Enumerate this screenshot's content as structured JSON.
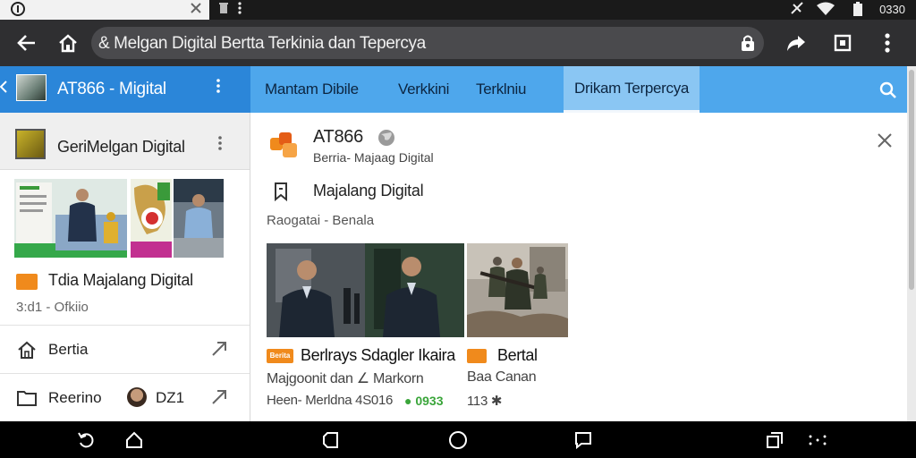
{
  "status_bar": {
    "time": "0330",
    "tab_icon": "info-circle-icon",
    "icons": [
      "close-icon",
      "trash-icon",
      "more-vert-icon",
      "no-signal-icon",
      "wifi-icon",
      "battery-icon"
    ]
  },
  "browser": {
    "url_text": "& Melgan Digital Bertta Terkinia dan Tepercya",
    "buttons": [
      "back-arrow-icon",
      "home-icon",
      "lock-icon",
      "share-icon",
      "tabs-icon",
      "more-vert-icon"
    ]
  },
  "app_header": {
    "title": "AT866 - Migital"
  },
  "tabs": [
    {
      "label": "Mantam Dibile",
      "active": false
    },
    {
      "label": "Verkkini",
      "active": false
    },
    {
      "label": "Terklniu",
      "active": false
    },
    {
      "label": "Drikam Terpercya",
      "active": true
    }
  ],
  "sidebar": {
    "group_title": "GeriMelgan Digital",
    "item_title": "Tdia Majalang Digital",
    "item_meta": "3:d1 - Ofkiio",
    "rows": [
      {
        "label": "Bertia",
        "icon": "home-icon"
      },
      {
        "label": "Reerino",
        "icon": "folder-icon",
        "number": "DZ1"
      }
    ]
  },
  "main": {
    "source_name": "AT866",
    "source_sub": "Berria- Majaag Digital",
    "topic_title": "Majalang Digital",
    "topic_sub": "Raogatai - Benala",
    "cards": [
      {
        "badge": "Berita",
        "headline": "Berlrays Sdagler Ikaira",
        "subline": "Majgoonit dan ∠ Markorn",
        "meta": "Heen- Merldna 4S016",
        "meta_extra": "● 0933"
      },
      {
        "badge": "",
        "headline": "Bertal",
        "subline": "Baa Canan",
        "meta": "113 ✱",
        "meta_extra": ""
      }
    ]
  },
  "colors": {
    "app_header_left": "#2b86d9",
    "tabs_bar": "#4ea7ec",
    "active_tab": "#8ac6f3",
    "accent_orange": "#f08a1c",
    "toolbar": "#2f2f31"
  }
}
